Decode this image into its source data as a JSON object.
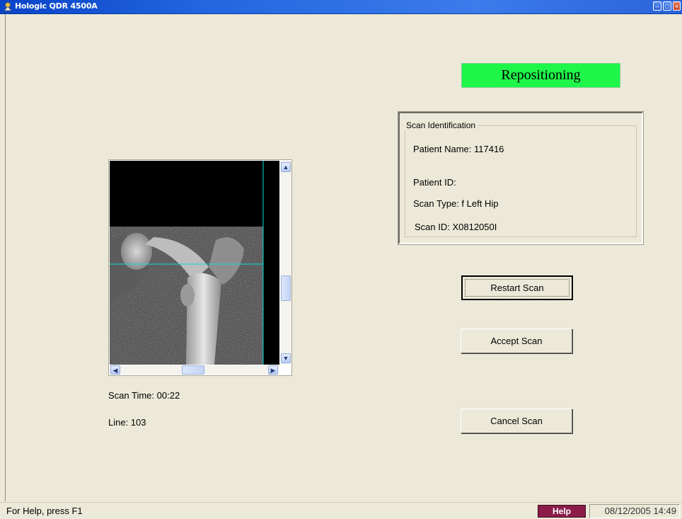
{
  "window": {
    "title": "Hologic QDR 4500A",
    "app_icon": "hologic-app-icon",
    "controls": [
      "minimize-icon",
      "maximize-icon",
      "close-icon"
    ]
  },
  "status_banner": {
    "text": "Repositioning",
    "color": "#1EF64A"
  },
  "scan_identification": {
    "legend": "Scan Identification",
    "patient_name": "Patient Name:  117416",
    "patient_id": "Patient ID:",
    "scan_type": "Scan Type: f Left Hip",
    "scan_id": "Scan ID: X0812050I"
  },
  "viewer": {
    "scroll_up": "up-arrow-icon",
    "scroll_down": "down-arrow-icon",
    "scroll_left": "left-arrow-icon",
    "scroll_right": "right-arrow-icon"
  },
  "scan_info": {
    "scan_time": "Scan Time: 00:22",
    "line": "Line: 103"
  },
  "buttons": {
    "restart": "Restart Scan",
    "accept": "Accept Scan",
    "cancel": "Cancel Scan"
  },
  "statusbar": {
    "hint": "For Help, press F1",
    "help": "Help",
    "datetime": "08/12/2005 14:49",
    "help_color": "#8B1C4A"
  }
}
